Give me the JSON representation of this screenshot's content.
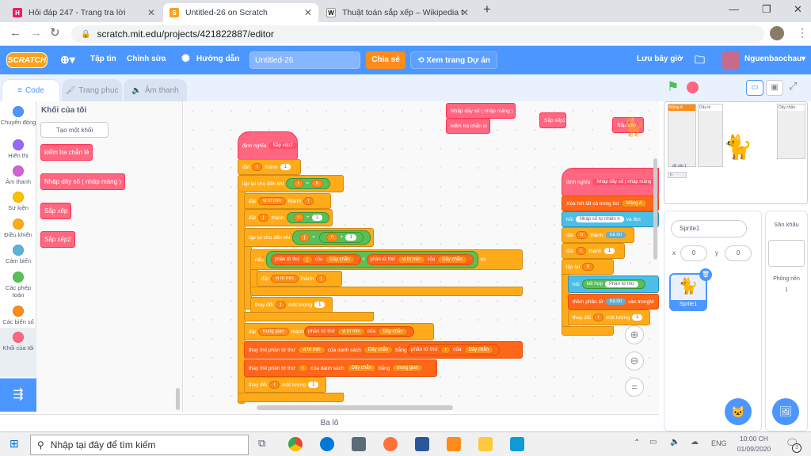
{
  "browser": {
    "tabs": [
      {
        "label": "Hỏi đáp 247 - Trang tra lời",
        "icon": "hoidap-favicon"
      },
      {
        "label": "Untitled-26 on Scratch",
        "icon": "scratch-favicon"
      },
      {
        "label": "Thuật toán sắp xếp – Wikipedia t",
        "icon": "wikipedia-favicon"
      }
    ],
    "url": "scratch.mit.edu/projects/421822887/editor"
  },
  "menu": {
    "logo": "SCRATCH",
    "file": "Tập tin",
    "edit": "Chỉnh sửa",
    "tutorials": "Hướng dẫn",
    "project_title": "Untitled-26",
    "share": "Chia sẻ",
    "see_project": "Xem trang Dự án",
    "save_now": "Lưu bây giờ",
    "username": "Nguenbaochau"
  },
  "editor_tabs": {
    "code": "Code",
    "costumes": "Trang phục",
    "sounds": "Âm thanh"
  },
  "categories": [
    {
      "label": "Chuyển động",
      "color": "#4c97ff"
    },
    {
      "label": "Hiển thị",
      "color": "#9966ff"
    },
    {
      "label": "Âm thanh",
      "color": "#cf63cf"
    },
    {
      "label": "Sự kiện",
      "color": "#ffbf00"
    },
    {
      "label": "Điều khiển",
      "color": "#ffab19"
    },
    {
      "label": "Cảm biến",
      "color": "#5cb1d6"
    },
    {
      "label": "Các phép toán",
      "color": "#59c059"
    },
    {
      "label": "Các biến số",
      "color": "#ff8c1a"
    },
    {
      "label": "Khối của tôi",
      "color": "#ff6680"
    }
  ],
  "palette": {
    "heading": "Khối của tôi",
    "make_block": "Tạo một khối",
    "blocks": [
      "kiểm tra chẵn lẻ",
      "Nhập dãy số ( nhập mảng )",
      "Sắp xếp",
      "Sắp xếp2"
    ]
  },
  "script1": {
    "define": "định nghĩa",
    "define_name": "Sắp xếp2",
    "set_i": {
      "label": "đặt",
      "var": "i",
      "to": "thành",
      "value": "1"
    },
    "repeat_until": {
      "label": "lặp lại cho đến khi",
      "left": "i",
      "op": "=",
      "right": "n"
    },
    "set_vitrimin": {
      "label": "đặt",
      "var": "vị trí min",
      "to": "thành",
      "value": "i"
    },
    "set_j": {
      "label": "đặt",
      "var": "j",
      "to": "thành",
      "left": "i",
      "op": "+",
      "right": "1"
    },
    "inner_repeat": {
      "label": "lặp lại cho đến khi",
      "left": "j",
      "op": "=",
      "right": "n",
      "plus": "+",
      "one": "1"
    },
    "if_block": {
      "if": "nếu",
      "item1": "phần tử thứ",
      "idx1": "j",
      "of": "của",
      "list": "Dãy chẵn",
      "lt": "<",
      "item2": "phần tử thứ",
      "idx2": "vị trí min",
      "of2": "của",
      "list2": "Dãy chẵn",
      "then": "thì"
    },
    "set_vitrimin2": {
      "label": "đặt",
      "var": "vị trí min",
      "to": "thành",
      "value": "j"
    },
    "change_j": {
      "label": "thay đổi",
      "var": "j",
      "by": "một lượng",
      "value": "1"
    },
    "set_trunggian": {
      "label": "đặt",
      "var": "trung gian",
      "to": "thành",
      "item": "phần tử thứ",
      "idx": "vị trí min",
      "of": "của",
      "list": "Dãy chẵn"
    },
    "replace1": {
      "label": "thay thế phần tử thứ",
      "idx": "vị trí min",
      "of": "của danh sách",
      "list": "Dãy chẵn",
      "with": "bằng",
      "item": "phần tử thứ",
      "idx2": "i",
      "of2": "của",
      "list2": "Dãy chẵn"
    },
    "replace2": {
      "label": "thay thế phần tử thứ",
      "idx": "i",
      "of": "của danh sách",
      "list": "Dãy chẵn",
      "with": "bằng",
      "value": "trung gian"
    },
    "change_i": {
      "label": "thay đổi",
      "var": "i",
      "by": "một lượng",
      "value": "1"
    }
  },
  "script2": {
    "define": "định nghĩa",
    "define_name": "Nhập dãy số ( nhập mảng",
    "clear": "Xóa hết tất cả trong list",
    "clear_list": "Mảng A",
    "ask": "hỏi",
    "ask_text": "Nhập số tự nhiên n",
    "ask_wait": "và đợi",
    "set_n": {
      "label": "đặt",
      "var": "n",
      "to": "thành",
      "value": "trả lời"
    },
    "set_i": {
      "label": "đặt",
      "var": "i",
      "to": "thành",
      "value": "1"
    },
    "repeat": "lặp lại",
    "repeat_n": "n",
    "ask2": "hỏi",
    "join": "kết hợp",
    "join_text": "Phần tử thứ",
    "add": "thêm phần tử",
    "add_value": "trả lời",
    "add_to": "vào trong",
    "add_list": "M",
    "change": "thay đổi",
    "change_var": "i",
    "change_by": "một lượng",
    "change_value": "1"
  },
  "floating_blocks": {
    "call_nhap": "Nhập dãy số ( nhập mảng )",
    "call_kiemtra": "kiểm tra chẵn lẻ",
    "call_sapxep2": "Sắp xếp2",
    "call_sapxep": "Sắp xếp"
  },
  "stage": {
    "list1_title": "Mảng A",
    "list2_title": "Dãy lẻ",
    "list3_title": "Dãy chẵn",
    "list_length_label": "độ dài 1",
    "var_n_label": "n"
  },
  "sprite_pane": {
    "sprite_name": "Sprite1",
    "x_label": "x",
    "x_value": "0",
    "y_label": "y",
    "y_value": "0",
    "thumb_label": "Sprite1"
  },
  "stage_pane": {
    "title": "Sân khấu",
    "backdrops_label": "Phông nền",
    "backdrops_count": "1"
  },
  "backpack": "Ba lô",
  "taskbar": {
    "search_placeholder": "Nhập tại đây để tìm kiếm",
    "lang": "ENG",
    "time": "10:00 CH",
    "date": "01/09/2020",
    "notif_count": "3"
  }
}
